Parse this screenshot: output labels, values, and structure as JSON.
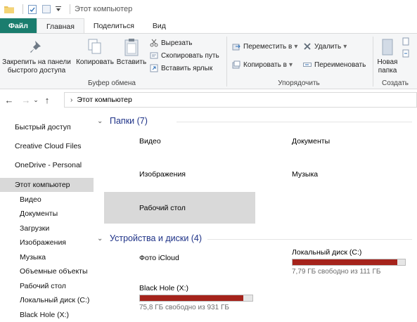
{
  "window": {
    "title": "Этот компьютер"
  },
  "ribbon_tabs": [
    "Файл",
    "Главная",
    "Поделиться",
    "Вид"
  ],
  "ribbon": {
    "pin_label": "Закрепить на панели быстрого доступа",
    "copy_label": "Копировать",
    "paste_label": "Вставить",
    "cut_label": "Вырезать",
    "copy_path_label": "Скопировать путь",
    "paste_shortcut_label": "Вставить ярлык",
    "clipboard_group": "Буфер обмена",
    "move_to_label": "Переместить в",
    "copy_to_label": "Копировать в",
    "delete_label": "Удалить",
    "rename_label": "Переименовать",
    "organize_group": "Упорядочить",
    "new_folder_label": "Новая папка",
    "new_group": "Создать"
  },
  "address": {
    "path": "Этот компьютер"
  },
  "navpane": {
    "quick_access": "Быстрый доступ",
    "creative_cloud": "Creative Cloud Files",
    "onedrive": "OneDrive - Personal",
    "this_pc": "Этот компьютер",
    "sub_items": [
      "Видео",
      "Документы",
      "Загрузки",
      "Изображения",
      "Музыка",
      "Объемные объекты",
      "Рабочий стол",
      "Локальный диск (C:)",
      "Black Hole (X:)"
    ]
  },
  "content": {
    "folders_header": "Папки (7)",
    "folders": [
      "Видео",
      "Документы",
      "Изображения",
      "Музыка",
      "Рабочий стол"
    ],
    "devices_header": "Устройства и диски (4)",
    "icloud": "Фото iCloud",
    "drive_c": {
      "name": "Локальный диск (C:)",
      "free": "7,79 ГБ свободно из 111 ГБ",
      "used_fraction": 0.93
    },
    "drive_x": {
      "name": "Black Hole (X:)",
      "free": "75,8 ГБ свободно из 931 ГБ",
      "used_fraction": 0.92
    }
  },
  "colors": {
    "file_tab": "#1a7d6e",
    "section_header": "#1e3287",
    "usage_bar": "#a5231b"
  }
}
